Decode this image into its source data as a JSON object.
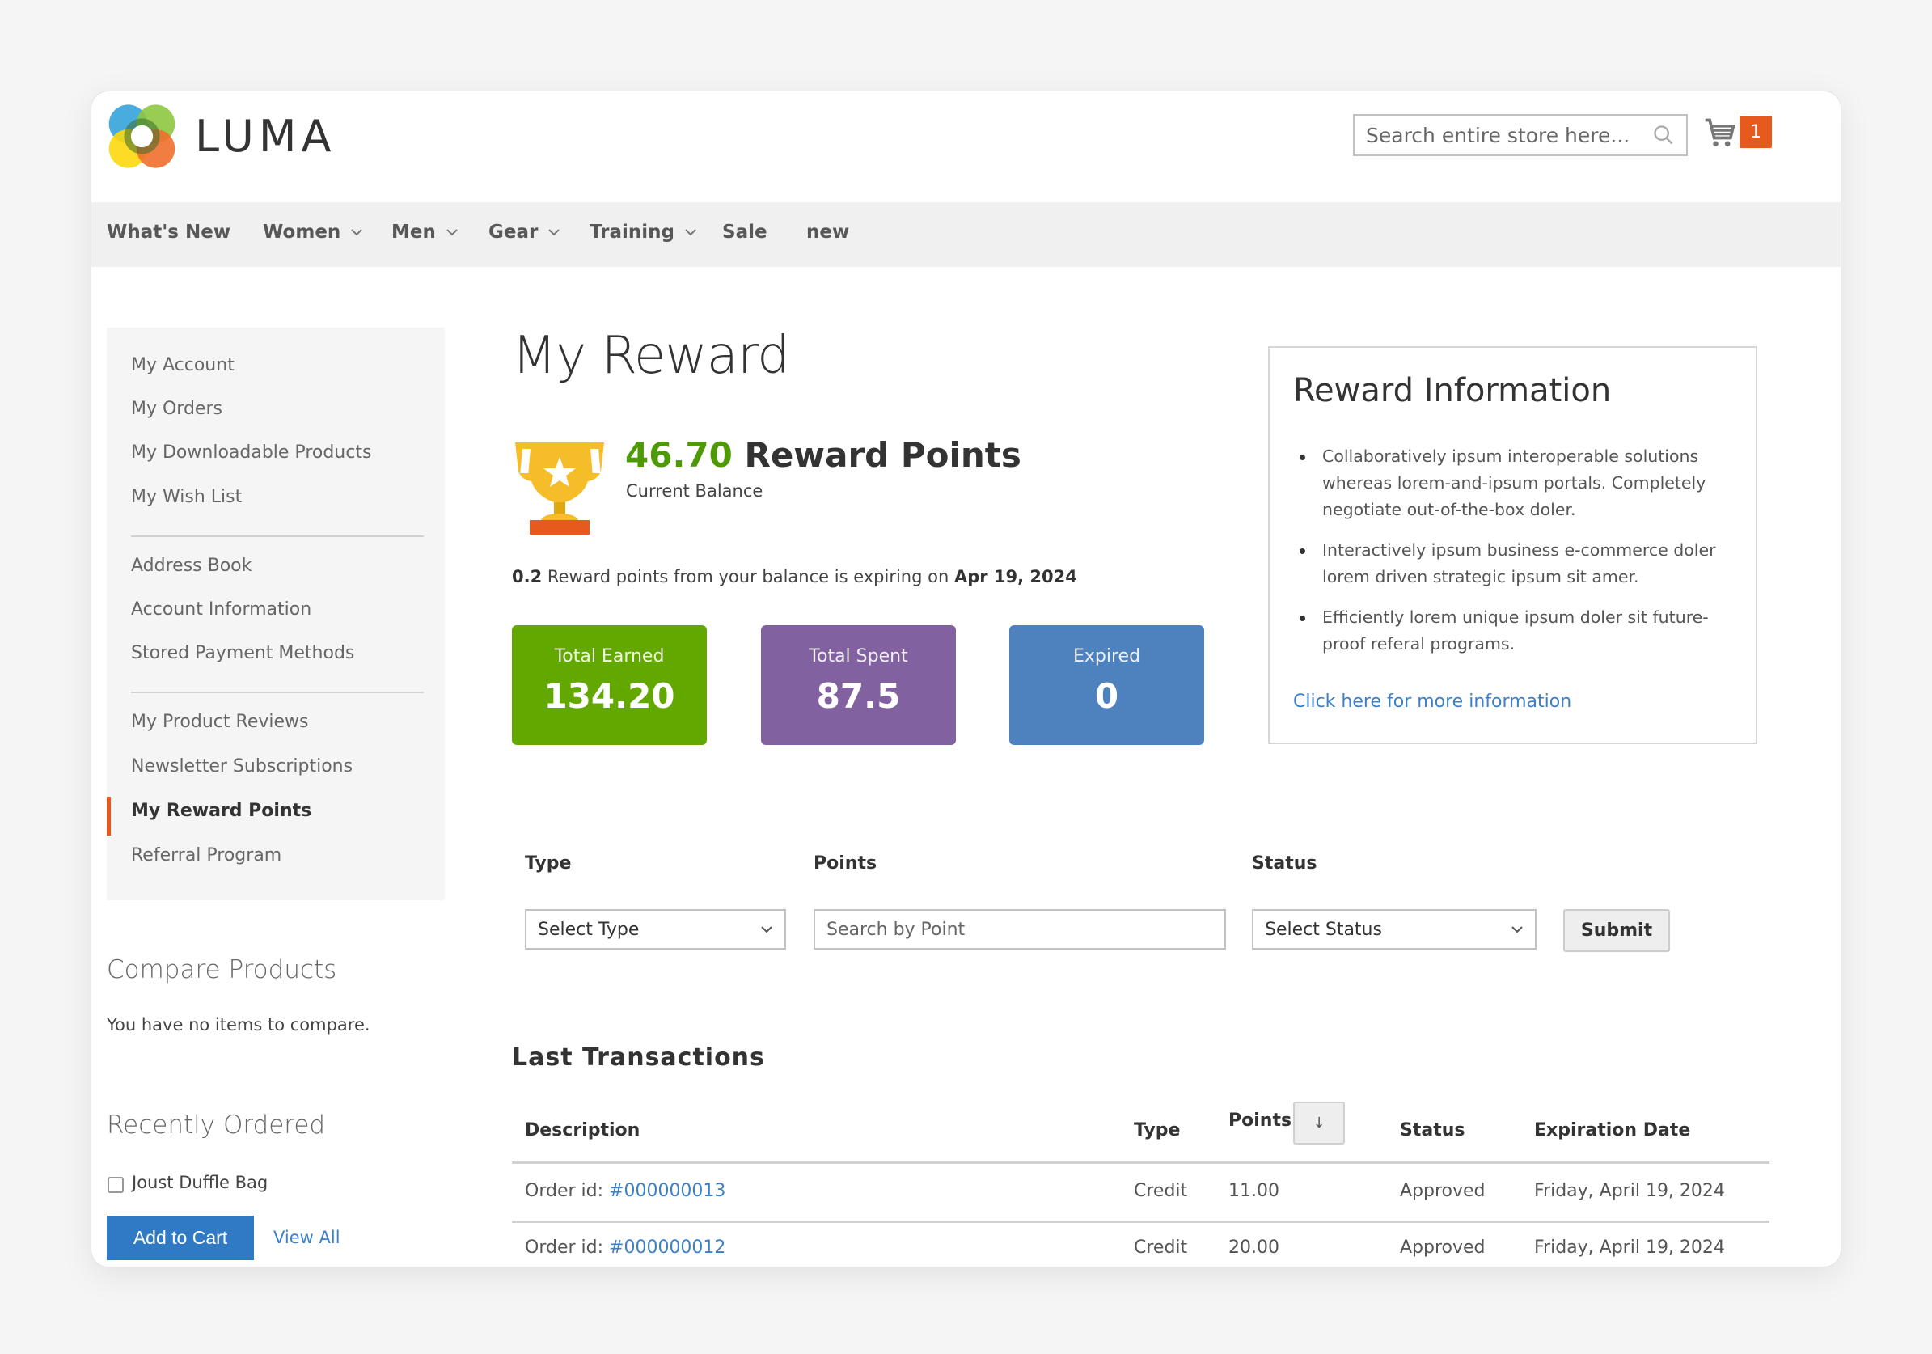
{
  "header": {
    "logo_text": "LUMA",
    "search_placeholder": "Search entire store here...",
    "cart_count": "1"
  },
  "nav": {
    "items": [
      {
        "label": "What's New",
        "has_dropdown": false
      },
      {
        "label": "Women",
        "has_dropdown": true
      },
      {
        "label": "Men",
        "has_dropdown": true
      },
      {
        "label": "Gear",
        "has_dropdown": true
      },
      {
        "label": "Training",
        "has_dropdown": true
      },
      {
        "label": "Sale",
        "has_dropdown": false
      },
      {
        "label": "new",
        "has_dropdown": false
      }
    ]
  },
  "sidebar": {
    "groups": [
      [
        "My Account",
        "My Orders",
        "My Downloadable Products",
        "My Wish List"
      ],
      [
        "Address Book",
        "Account Information",
        "Stored Payment Methods"
      ],
      [
        "My Product Reviews",
        "Newsletter Subscriptions",
        "My Reward Points",
        "Referral Program"
      ]
    ],
    "active": "My Reward Points",
    "compare": {
      "title": "Compare Products",
      "empty_text": "You have no items to compare."
    },
    "recent": {
      "title": "Recently Ordered",
      "item": "Joust Duffle Bag",
      "add_to_cart": "Add to Cart",
      "view_all": "View All"
    }
  },
  "main": {
    "title": "My Reward",
    "balance": {
      "value": "46.70",
      "unit": "Reward Points",
      "label": "Current Balance"
    },
    "expiry": {
      "points": "0.2",
      "text": "Reward points from your balance is expiring on",
      "date": "Apr 19, 2024"
    },
    "stats": [
      {
        "label": "Total Earned",
        "value": "134.20",
        "color": "#63a800"
      },
      {
        "label": "Total Spent",
        "value": "87.5",
        "color": "#8161a0"
      },
      {
        "label": "Expired",
        "value": "0",
        "color": "#4e82bf"
      }
    ],
    "info": {
      "title": "Reward Information",
      "bullets": [
        "Collaboratively ipsum interoperable solutions whereas lorem-and-ipsum portals. Completely negotiate out-of-the-box doler.",
        "Interactively ipsum business e-commerce doler lorem driven strategic ipsum sit amer.",
        "Efficiently lorem unique ipsum doler sit future-proof referal programs."
      ],
      "link": "Click here for more information"
    },
    "filters": {
      "type_label": "Type",
      "type_value": "Select Type",
      "points_label": "Points",
      "points_placeholder": "Search by Point",
      "status_label": "Status",
      "status_value": "Select Status",
      "submit": "Submit"
    },
    "transactions": {
      "title": "Last Transactions",
      "columns": [
        "Description",
        "Type",
        "Points",
        "Status",
        "Expiration Date"
      ],
      "sort_icon": "↓",
      "rows": [
        {
          "desc_prefix": "Order id:",
          "order": "#000000013",
          "type": "Credit",
          "points": "11.00",
          "status": "Approved",
          "expires": "Friday, April 19, 2024"
        },
        {
          "desc_prefix": "Order id:",
          "order": "#000000012",
          "type": "Credit",
          "points": "20.00",
          "status": "Approved",
          "expires": "Friday, April 19, 2024"
        }
      ]
    }
  },
  "colors": {
    "accent": "#e65a1e",
    "link": "#3b80c8",
    "primary_button": "#2f7ac3",
    "balance_green": "#4e9a06"
  }
}
